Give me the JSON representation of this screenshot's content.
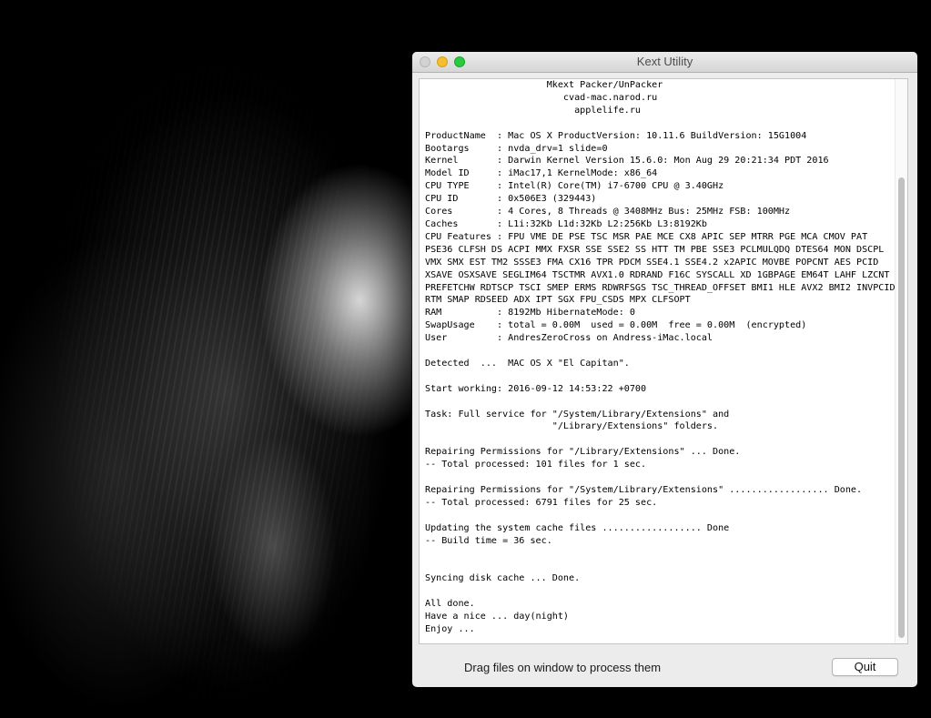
{
  "window": {
    "title": "Kext Utility"
  },
  "log": {
    "lines": [
      "                      Mkext Packer/UnPacker",
      "                         cvad-mac.narod.ru",
      "                           applelife.ru",
      "",
      "ProductName  : Mac OS X ProductVersion: 10.11.6 BuildVersion: 15G1004",
      "Bootargs     : nvda_drv=1 slide=0",
      "Kernel       : Darwin Kernel Version 15.6.0: Mon Aug 29 20:21:34 PDT 2016",
      "Model ID     : iMac17,1 KernelMode: x86_64",
      "CPU TYPE     : Intel(R) Core(TM) i7-6700 CPU @ 3.40GHz",
      "CPU ID       : 0x506E3 (329443)",
      "Cores        : 4 Cores, 8 Threads @ 3408MHz Bus: 25MHz FSB: 100MHz",
      "Caches       : L1i:32Kb L1d:32Kb L2:256Kb L3:8192Kb",
      "CPU Features : FPU VME DE PSE TSC MSR PAE MCE CX8 APIC SEP MTRR PGE MCA CMOV PAT",
      "PSE36 CLFSH DS ACPI MMX FXSR SSE SSE2 SS HTT TM PBE SSE3 PCLMULQDQ DTES64 MON DSCPL",
      "VMX SMX EST TM2 SSSE3 FMA CX16 TPR PDCM SSE4.1 SSE4.2 x2APIC MOVBE POPCNT AES PCID",
      "XSAVE OSXSAVE SEGLIM64 TSCTMR AVX1.0 RDRAND F16C SYSCALL XD 1GBPAGE EM64T LAHF LZCNT",
      "PREFETCHW RDTSCP TSCI SMEP ERMS RDWRFSGS TSC_THREAD_OFFSET BMI1 HLE AVX2 BMI2 INVPCID",
      "RTM SMAP RDSEED ADX IPT SGX FPU_CSDS MPX CLFSOPT",
      "RAM          : 8192Mb HibernateMode: 0",
      "SwapUsage    : total = 0.00M  used = 0.00M  free = 0.00M  (encrypted)",
      "User         : AndresZeroCross on Andress-iMac.local",
      "",
      "Detected  ...  MAC OS X \"El Capitan\".",
      "",
      "Start working: 2016-09-12 14:53:22 +0700",
      "",
      "Task: Full service for \"/System/Library/Extensions\" and",
      "                       \"/Library/Extensions\" folders.",
      "",
      "Repairing Permissions for \"/Library/Extensions\" ... Done.",
      "-- Total processed: 101 files for 1 sec.",
      "",
      "Repairing Permissions for \"/System/Library/Extensions\" .................. Done.",
      "-- Total processed: 6791 files for 25 sec.",
      "",
      "Updating the system cache files .................. Done",
      "-- Build time = 36 sec.",
      "",
      "",
      "Syncing disk cache ... Done.",
      "",
      "All done.",
      "Have a nice ... day(night)",
      "Enjoy ..."
    ]
  },
  "footer": {
    "hint": "Drag files on window to process them",
    "quit_label": "Quit"
  }
}
